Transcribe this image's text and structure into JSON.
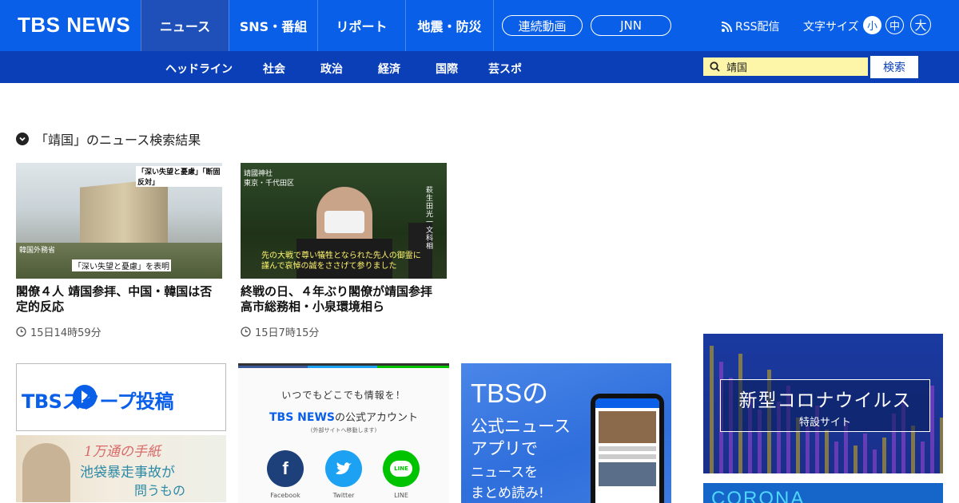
{
  "header": {
    "logo": "TBS NEWS",
    "nav": [
      "ニュース",
      "SNS・番組",
      "リポート",
      "地震・防災"
    ],
    "pills": [
      "連続動画",
      "JNN"
    ],
    "rss": "RSS配信",
    "fontsize_label": "文字サイズ",
    "fontsize_options": [
      "小",
      "中",
      "大"
    ],
    "fontsize_selected": "小"
  },
  "subnav": {
    "items": [
      "ヘッドライン",
      "社会",
      "政治",
      "経済",
      "国際",
      "芸スポ"
    ],
    "search_value": "靖国",
    "search_button": "検索"
  },
  "results": {
    "heading": "「靖国」のニュース検索結果",
    "articles": [
      {
        "title": "閣僚４人 靖国参拝、中国・韓国は否定的反応",
        "time": "15日14時59分",
        "thumb_caption_top": "「深い失望と憂慮」「断固反対」",
        "thumb_caption_bottom": "「深い失望と憂慮」を表明",
        "thumb_label": "韓国外務省"
      },
      {
        "title": "終戦の日、４年ぶり閣僚が靖国参拝 高市総務相・小泉環境相ら",
        "time": "15日7時15分",
        "thumb_caption_top": "靖國神社",
        "thumb_caption_place": "東京・千代田区",
        "thumb_caption_bottom": "先の大戦で尊い犠牲となられた先人の御霊に謹んで哀悼の誠をささげて参りました",
        "thumb_label": "萩生田光一 文科相"
      }
    ]
  },
  "banners": {
    "scoop": "TBSスクープ投稿",
    "letters_top": "1万通の手紙",
    "letters_mid": "池袋暴走事故が",
    "letters_bot": "問うもの",
    "sns_top": "いつでもどこでも情報を！",
    "sns_title": "TBS NEWS",
    "sns_suffix": "の公式アカウント",
    "sns_note": "(外部サイトへ移動します)",
    "sns_items": [
      "Facebook",
      "Twitter",
      "LINE"
    ],
    "app_lines": [
      "TBSの",
      "公式ニュース",
      "アプリで",
      "ニュースを",
      "まとめ読み!"
    ],
    "corona_title": "新型コロナウイルス",
    "corona_sub": "特設サイト",
    "corona2": "CORONA"
  },
  "colors": {
    "brand": "#0a5fe8",
    "subnav": "#0a3fb8",
    "search_bg": "#fdf5a8"
  }
}
